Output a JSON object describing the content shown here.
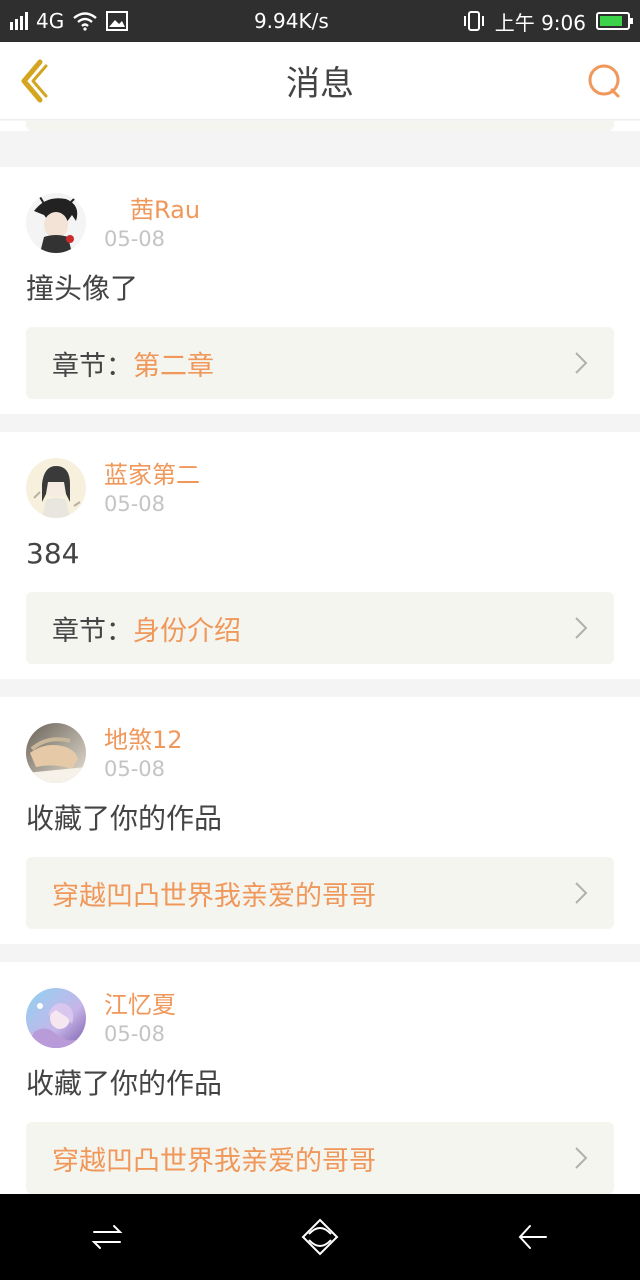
{
  "status_bar": {
    "network": "4G",
    "speed": "9.94K/s",
    "time": "上午 9:06",
    "battery_level": 0.85,
    "icons": [
      "signal-icon",
      "wifi-icon",
      "image-icon",
      "vibrate-icon",
      "battery-icon"
    ]
  },
  "header": {
    "title": "消息",
    "icons": [
      "back-icon",
      "search-icon"
    ]
  },
  "colors": {
    "accent": "#f0975a",
    "back_icon": "#d4a51f",
    "ref_bg": "#f5f5ef"
  },
  "messages": [
    {
      "username": "茜Rau",
      "date": "05-08",
      "text": "撞头像了",
      "ref_prefix": "章节：",
      "ref_target": "第二章"
    },
    {
      "username": "蓝家第二",
      "date": "05-08",
      "text": "384",
      "ref_prefix": "章节：",
      "ref_target": "身份介绍"
    },
    {
      "username": "地煞12",
      "date": "05-08",
      "text": "收藏了你的作品",
      "ref_prefix": "",
      "ref_target": "穿越凹凸世界我亲爱的哥哥"
    },
    {
      "username": "江忆夏",
      "date": "05-08",
      "text": "收藏了你的作品",
      "ref_prefix": "",
      "ref_target": "穿越凹凸世界我亲爱的哥哥"
    }
  ],
  "nav_bar": {
    "icons": [
      "menu-switch-icon",
      "home-icon",
      "back-arrow-icon"
    ]
  }
}
